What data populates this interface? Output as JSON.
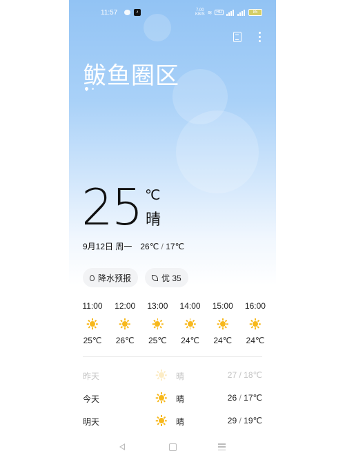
{
  "status_bar": {
    "time": "11:57",
    "net_speed_value": "7.00",
    "net_speed_unit": "KB/S",
    "hd_label": "HD",
    "battery_text": "85"
  },
  "location": {
    "city": "鲅鱼圈区"
  },
  "current": {
    "temperature": "25",
    "unit": "℃",
    "condition": "晴",
    "date": "9月12日 周一",
    "high": "26℃",
    "sep": "/",
    "low": "17℃"
  },
  "chips": [
    {
      "label": "降水预报",
      "icon": "drop-icon"
    },
    {
      "label": "优 35",
      "icon": "leaf-icon"
    }
  ],
  "hourly": [
    {
      "time": "11:00",
      "icon": "sun-icon",
      "temp": "25℃"
    },
    {
      "time": "12:00",
      "icon": "sun-icon",
      "temp": "26℃"
    },
    {
      "time": "13:00",
      "icon": "sun-icon",
      "temp": "25℃"
    },
    {
      "time": "14:00",
      "icon": "sun-icon",
      "temp": "24℃"
    },
    {
      "time": "15:00",
      "icon": "sun-icon",
      "temp": "24℃"
    },
    {
      "time": "16:00",
      "icon": "sun-icon",
      "temp": "24℃"
    }
  ],
  "daily": [
    {
      "day": "昨天",
      "icon": "sun-icon",
      "condition": "晴",
      "high": "27",
      "range_sep": " / ",
      "low": "18℃"
    },
    {
      "day": "今天",
      "icon": "sun-icon",
      "condition": "晴",
      "high": "26",
      "range_sep": " / ",
      "low": "17℃"
    },
    {
      "day": "明天",
      "icon": "sun-icon",
      "condition": "晴",
      "high": "29",
      "range_sep": " / ",
      "low": "19℃"
    }
  ],
  "colors": {
    "sun": "#f7b81c",
    "sky_top": "#92c3f4",
    "chip_bg": "#f2f3f5"
  }
}
